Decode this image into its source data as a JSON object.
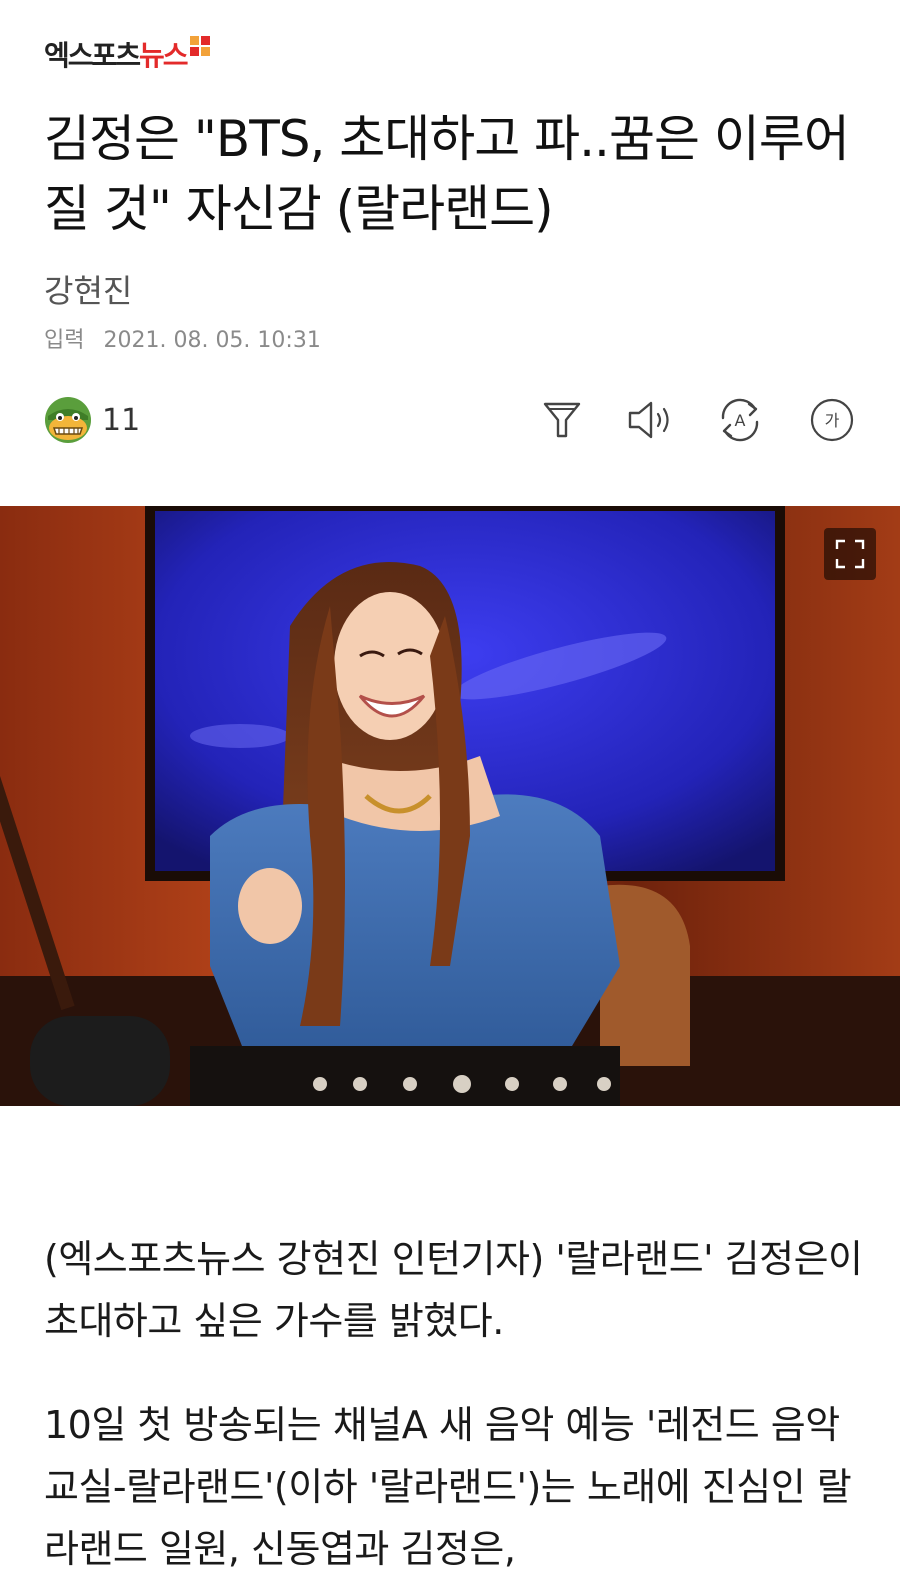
{
  "header": {
    "logo_text_dark": "엑스포츠",
    "logo_text_red": "뉴스"
  },
  "article": {
    "headline": "김정은 \"BTS, 초대하고 파..꿈은 이루어질 것\" 자신감 (랄라랜드)",
    "author": "강현진",
    "date_label": "입력",
    "date_value": "2021. 08. 05. 10:31",
    "reaction_icon": "green-creature-emoji-icon",
    "reaction_count": "11",
    "paragraphs": [
      "(엑스포츠뉴스 강현진 인턴기자) '랄라랜드' 김정은이 초대하고 싶은 가수를 밝혔다.",
      "10일 첫 방송되는 채널A 새 음악 예능 '레전드 음악교실-랄라랜드'(이하 '랄라랜드')는 노래에 진심인 랄라랜드 일원, 신동엽과 김정은,"
    ]
  },
  "toolbar": {
    "items": [
      {
        "name": "filter-icon"
      },
      {
        "name": "speaker-icon"
      },
      {
        "name": "translate-icon"
      },
      {
        "name": "font-size-icon",
        "glyph": "가"
      }
    ]
  },
  "image": {
    "expand_icon": "fullscreen-icon"
  },
  "colors": {
    "brand_red": "#e32a2a",
    "brand_orange": "#f2a23a",
    "text": "#1a1a1a",
    "meta": "#8a8a8a"
  }
}
